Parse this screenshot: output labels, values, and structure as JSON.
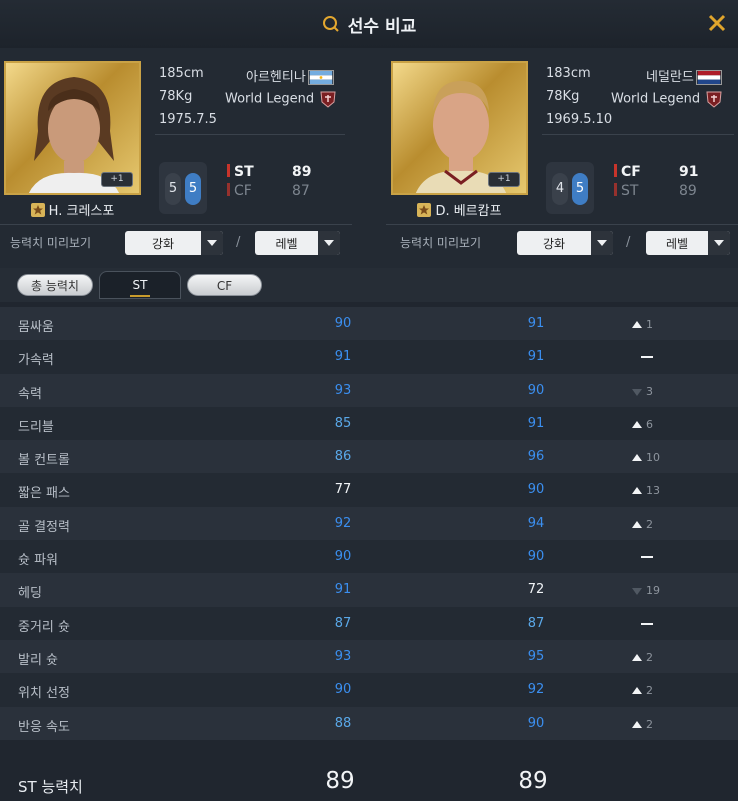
{
  "header": {
    "title": "선수 비교",
    "search_icon": "search-icon",
    "close_icon": "close-icon"
  },
  "left_player": {
    "name": "H. 크레스포",
    "height": "185cm",
    "weight": "78Kg",
    "birth": "1975.7.5",
    "nation": "아르헨티나",
    "club": "World Legend",
    "plus": "+1",
    "foot_left": "5",
    "foot_right": "5",
    "positions": [
      {
        "pos": "ST",
        "ovr": "89"
      },
      {
        "pos": "CF",
        "ovr": "87"
      }
    ]
  },
  "right_player": {
    "name": "D. 베르캄프",
    "height": "183cm",
    "weight": "78Kg",
    "birth": "1969.5.10",
    "nation": "네덜란드",
    "club": "World Legend",
    "plus": "+1",
    "foot_left": "4",
    "foot_right": "5",
    "positions": [
      {
        "pos": "CF",
        "ovr": "91"
      },
      {
        "pos": "ST",
        "ovr": "89"
      }
    ]
  },
  "preview": {
    "label": "능력치 미리보기",
    "enhance": "강화",
    "level": "레벨",
    "slash": "/"
  },
  "tabs": [
    {
      "label": "총 능력치"
    },
    {
      "label": "ST"
    },
    {
      "label": "CF"
    }
  ],
  "stats": [
    {
      "name": "몸싸움",
      "v1": "90",
      "v2": "91",
      "diff": "1",
      "dir": "up"
    },
    {
      "name": "가속력",
      "v1": "91",
      "v2": "91",
      "diff": "",
      "dir": "eq"
    },
    {
      "name": "속력",
      "v1": "93",
      "v2": "90",
      "diff": "3",
      "dir": "down"
    },
    {
      "name": "드리블",
      "v1": "85",
      "v2": "91",
      "diff": "6",
      "dir": "up"
    },
    {
      "name": "볼 컨트롤",
      "v1": "86",
      "v2": "96",
      "diff": "10",
      "dir": "up"
    },
    {
      "name": "짧은 패스",
      "v1": "77",
      "v2": "90",
      "diff": "13",
      "dir": "up"
    },
    {
      "name": "골 결정력",
      "v1": "92",
      "v2": "94",
      "diff": "2",
      "dir": "up"
    },
    {
      "name": "슛 파워",
      "v1": "90",
      "v2": "90",
      "diff": "",
      "dir": "eq"
    },
    {
      "name": "헤딩",
      "v1": "91",
      "v2": "72",
      "diff": "19",
      "dir": "down"
    },
    {
      "name": "중거리 슛",
      "v1": "87",
      "v2": "87",
      "diff": "",
      "dir": "eq"
    },
    {
      "name": "발리 슛",
      "v1": "93",
      "v2": "95",
      "diff": "2",
      "dir": "up"
    },
    {
      "name": "위치 선정",
      "v1": "90",
      "v2": "92",
      "diff": "2",
      "dir": "up"
    },
    {
      "name": "반응 속도",
      "v1": "88",
      "v2": "90",
      "diff": "2",
      "dir": "up"
    }
  ],
  "total": {
    "label": "ST 능력치",
    "v1": "89",
    "v2": "89"
  },
  "colors": {
    "accent": "#c89b2c",
    "stat_blue": "#3b8ff0",
    "stat_lightblue": "#5aa8e8",
    "position_red": "#c8342b"
  }
}
